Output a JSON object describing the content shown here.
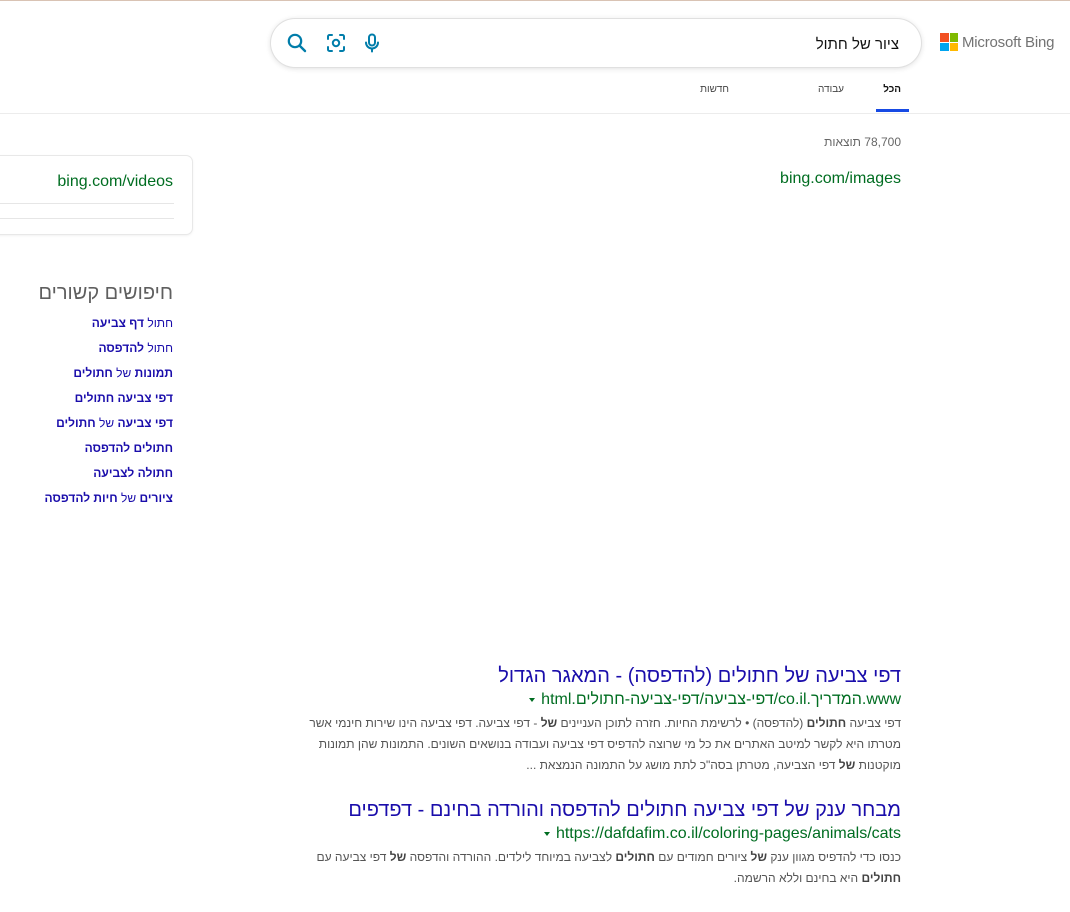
{
  "brand": {
    "name": "Microsoft Bing",
    "colors": [
      "#f25022",
      "#7fba00",
      "#00a4ef",
      "#ffb900"
    ]
  },
  "search": {
    "query": "ציור של חתול",
    "icons": [
      "search-icon",
      "visual-search-icon",
      "microphone-icon"
    ]
  },
  "tabs": [
    {
      "label": "הכל",
      "active": true
    },
    {
      "label": "עבודה",
      "active": false
    },
    {
      "label": "חדשות",
      "active": false
    }
  ],
  "results_count": "78,700 תוצאות",
  "images_link": "bing.com/images",
  "videos_link": "bing.com/videos",
  "related": {
    "title": "חיפושים קשורים",
    "items": [
      [
        [
          "חתול ",
          false
        ],
        [
          "דף צביעה",
          true
        ]
      ],
      [
        [
          "חתול ",
          false
        ],
        [
          "להדפסה",
          true
        ]
      ],
      [
        [
          "תמונות",
          true
        ],
        [
          " של ",
          false
        ],
        [
          "חתולים",
          true
        ]
      ],
      [
        [
          "דפי צביעה חתולים",
          true
        ]
      ],
      [
        [
          "דפי צביעה",
          true
        ],
        [
          " של ",
          false
        ],
        [
          "חתולים",
          true
        ]
      ],
      [
        [
          "חתולים להדפסה",
          true
        ]
      ],
      [
        [
          "חתולה לצביעה",
          true
        ]
      ],
      [
        [
          "ציורים",
          true
        ],
        [
          " של ",
          false
        ],
        [
          "חיות להדפסה",
          true
        ]
      ]
    ]
  },
  "results": [
    {
      "title": "דפי צביעה של חתולים (להדפסה) - המאגר הגדול",
      "url": "www.המדריך.co.il/דפי-צביעה/דפי-צביעה-חתולים.html",
      "snippet_lines": [
        [
          [
            "דפי צביעה ",
            false
          ],
          [
            "חתולים",
            true
          ],
          [
            " (להדפסה) • לרשימת החיות. חזרה לתוכן העניינים ",
            false
          ],
          [
            "של",
            true
          ],
          [
            " - דפי צביעה. דפי צביעה הינו שירות חינמי אשר",
            false
          ]
        ],
        [
          [
            "מטרתו היא לקשר למיטב האתרים את כל מי שרוצה להדפיס דפי צביעה ועבודה בנושאים השונים. התמונות שהן תמונות",
            false
          ]
        ],
        [
          [
            "מוקטנות ",
            false
          ],
          [
            "של",
            true
          ],
          [
            " דפי הצביעה, מטרתן בסה\"כ לתת מושג על התמונה הנמצאת ...",
            false
          ]
        ]
      ]
    },
    {
      "title": "מבחר ענק של דפי צביעה חתולים להדפסה והורדה בחינם - דפדפים",
      "url": "https://dafdafim.co.il/coloring-pages/animals/cats",
      "snippet_lines": [
        [
          [
            "כנסו כדי להדפיס מגוון ענק ",
            false
          ],
          [
            "של",
            true
          ],
          [
            " ציורים חמודים עם ",
            false
          ],
          [
            "חתולים",
            true
          ],
          [
            " לצביעה במיוחד לילדים. ההורדה והדפסה ",
            false
          ],
          [
            "של",
            true
          ],
          [
            " דפי צביעה עם",
            false
          ]
        ],
        [
          [
            "חתולים",
            true
          ],
          [
            " היא בחינם וללא הרשמה.",
            false
          ]
        ]
      ]
    }
  ]
}
